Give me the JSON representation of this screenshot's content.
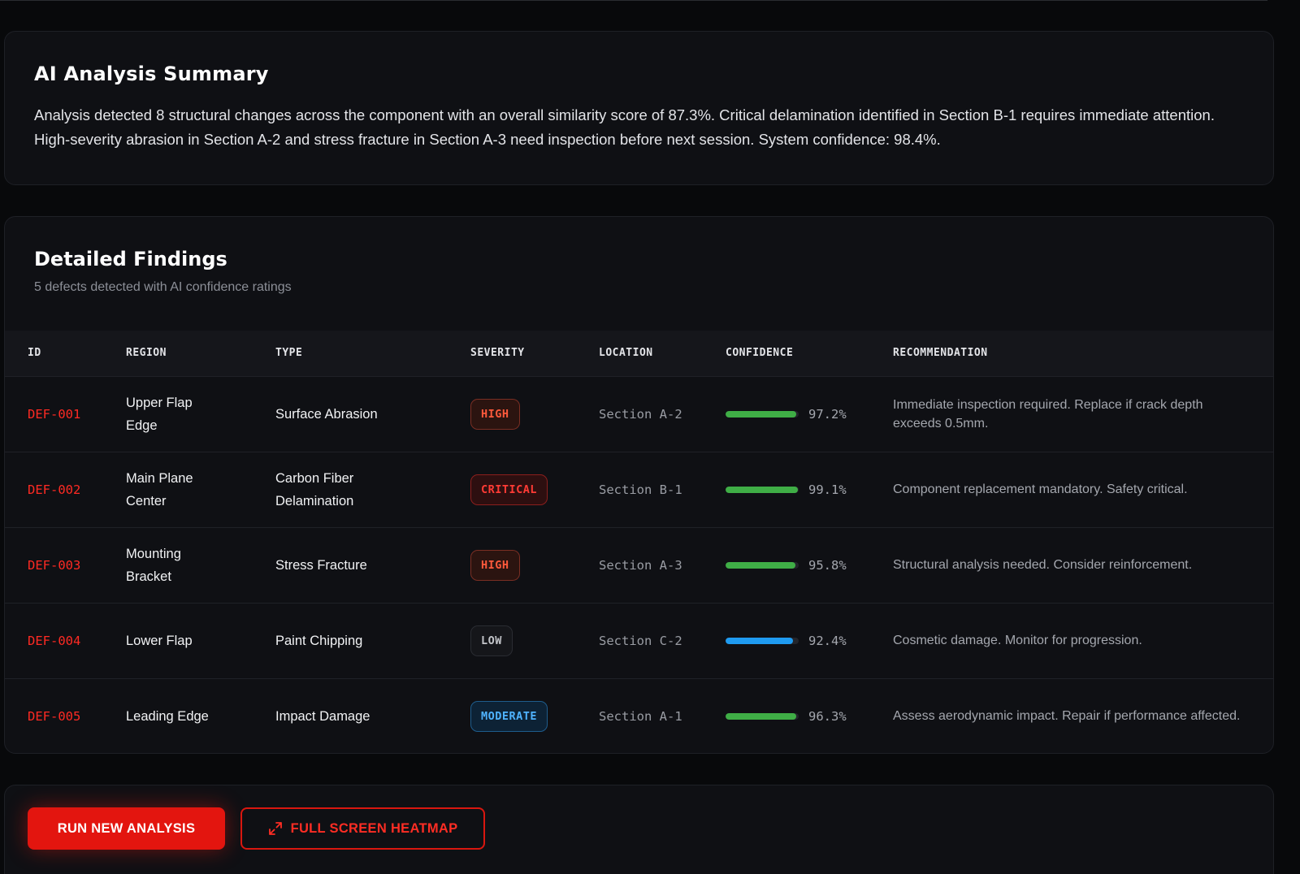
{
  "summary": {
    "title": "AI Analysis Summary",
    "text": "Analysis detected 8 structural changes across the component with an overall similarity score of 87.3%. Critical delamination identified in Section B-1 requires immediate attention. High-severity abrasion in Section A-2 and stress fracture in Section A-3 need inspection before next session. System confidence: 98.4%."
  },
  "findings": {
    "title": "Detailed Findings",
    "subtitle": "5 defects detected with AI confidence ratings",
    "columns": [
      "ID",
      "REGION",
      "TYPE",
      "SEVERITY",
      "LOCATION",
      "CONFIDENCE",
      "RECOMMENDATION"
    ],
    "rows": [
      {
        "id": "DEF-001",
        "region": "Upper Flap Edge",
        "type": "Surface Abrasion",
        "severity": "HIGH",
        "location": "Section A-2",
        "confidence": "97.2%",
        "confidence_value": 97.2,
        "recommendation": "Immediate inspection required. Replace if crack depth exceeds 0.5mm."
      },
      {
        "id": "DEF-002",
        "region": "Main Plane Center",
        "type": "Carbon Fiber Delamination",
        "severity": "CRITICAL",
        "location": "Section B-1",
        "confidence": "99.1%",
        "confidence_value": 99.1,
        "recommendation": "Component replacement mandatory. Safety critical."
      },
      {
        "id": "DEF-003",
        "region": "Mounting Bracket",
        "type": "Stress Fracture",
        "severity": "HIGH",
        "location": "Section A-3",
        "confidence": "95.8%",
        "confidence_value": 95.8,
        "recommendation": "Structural analysis needed. Consider reinforcement."
      },
      {
        "id": "DEF-004",
        "region": "Lower Flap",
        "type": "Paint Chipping",
        "severity": "LOW",
        "location": "Section C-2",
        "confidence": "92.4%",
        "confidence_value": 92.4,
        "recommendation": "Cosmetic damage. Monitor for progression."
      },
      {
        "id": "DEF-005",
        "region": "Leading Edge",
        "type": "Impact Damage",
        "severity": "MODERATE",
        "location": "Section A-1",
        "confidence": "96.3%",
        "confidence_value": 96.3,
        "recommendation": "Assess aerodynamic impact. Repair if performance affected."
      }
    ]
  },
  "actions": {
    "run_label": "RUN NEW ANALYSIS",
    "heatmap_label": "FULL SCREEN HEATMAP",
    "heatmap_icon": "expand-icon"
  },
  "colors": {
    "accent": "#e3150f",
    "defect_id": "#ff2a23",
    "bar_green": "#3fae46",
    "bar_blue": "#1f9bf0"
  }
}
